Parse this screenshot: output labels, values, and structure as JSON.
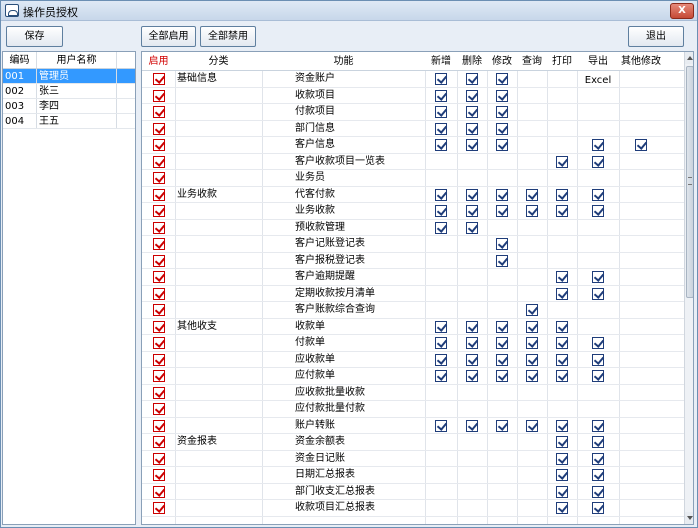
{
  "window": {
    "title": "操作员授权",
    "close_label": "X"
  },
  "toolbar": {
    "save": "保存",
    "enable_all": "全部启用",
    "disable_all": "全部禁用",
    "exit": "退出"
  },
  "users": {
    "headers": [
      "编码",
      "用户名称"
    ],
    "rows": [
      {
        "code": "001",
        "name": "管理员",
        "selected": true
      },
      {
        "code": "002",
        "name": "张三",
        "selected": false
      },
      {
        "code": "003",
        "name": "李四",
        "selected": false
      },
      {
        "code": "004",
        "name": "王五",
        "selected": false
      }
    ]
  },
  "grid": {
    "headers": [
      "启用",
      "分类",
      "功能",
      "新增",
      "删除",
      "修改",
      "查询",
      "打印",
      "导出Excel",
      "其他修改"
    ],
    "rows": [
      {
        "category": "基础信息",
        "func": "资金账户",
        "perms": [
          1,
          1,
          1,
          0,
          0,
          0,
          0
        ]
      },
      {
        "category": "",
        "func": "收款项目",
        "perms": [
          1,
          1,
          1,
          0,
          0,
          0,
          0
        ]
      },
      {
        "category": "",
        "func": "付款项目",
        "perms": [
          1,
          1,
          1,
          0,
          0,
          0,
          0
        ]
      },
      {
        "category": "",
        "func": "部门信息",
        "perms": [
          1,
          1,
          1,
          0,
          0,
          0,
          0
        ]
      },
      {
        "category": "",
        "func": "客户信息",
        "perms": [
          1,
          1,
          1,
          0,
          0,
          1,
          1
        ]
      },
      {
        "category": "",
        "func": "客户收款项目一览表",
        "perms": [
          0,
          0,
          0,
          0,
          1,
          1,
          0
        ]
      },
      {
        "category": "",
        "func": "业务员",
        "perms": [
          0,
          0,
          0,
          0,
          0,
          0,
          0
        ]
      },
      {
        "category": "业务收款",
        "func": "代客付款",
        "perms": [
          1,
          1,
          1,
          1,
          1,
          1,
          0
        ]
      },
      {
        "category": "",
        "func": "业务收款",
        "perms": [
          1,
          1,
          1,
          1,
          1,
          1,
          0
        ]
      },
      {
        "category": "",
        "func": "预收款管理",
        "perms": [
          1,
          1,
          0,
          0,
          0,
          0,
          0
        ]
      },
      {
        "category": "",
        "func": "客户记账登记表",
        "perms": [
          0,
          0,
          1,
          0,
          0,
          0,
          0
        ]
      },
      {
        "category": "",
        "func": "客户报税登记表",
        "perms": [
          0,
          0,
          1,
          0,
          0,
          0,
          0
        ]
      },
      {
        "category": "",
        "func": "客户逾期提醒",
        "perms": [
          0,
          0,
          0,
          0,
          1,
          1,
          0
        ]
      },
      {
        "category": "",
        "func": "定期收款按月清单",
        "perms": [
          0,
          0,
          0,
          0,
          1,
          1,
          0
        ]
      },
      {
        "category": "",
        "func": "客户账款综合查询",
        "perms": [
          0,
          0,
          0,
          1,
          0,
          0,
          0
        ]
      },
      {
        "category": "其他收支",
        "func": "收款单",
        "perms": [
          1,
          1,
          1,
          1,
          1,
          0,
          0
        ]
      },
      {
        "category": "",
        "func": "付款单",
        "perms": [
          1,
          1,
          1,
          1,
          1,
          1,
          0
        ]
      },
      {
        "category": "",
        "func": "应收款单",
        "perms": [
          1,
          1,
          1,
          1,
          1,
          1,
          0
        ]
      },
      {
        "category": "",
        "func": "应付款单",
        "perms": [
          1,
          1,
          1,
          1,
          1,
          1,
          0
        ]
      },
      {
        "category": "",
        "func": "应收款批量收款",
        "perms": [
          0,
          0,
          0,
          0,
          0,
          0,
          0
        ]
      },
      {
        "category": "",
        "func": "应付款批量付款",
        "perms": [
          0,
          0,
          0,
          0,
          0,
          0,
          0
        ]
      },
      {
        "category": "",
        "func": "账户转账",
        "perms": [
          1,
          1,
          1,
          1,
          1,
          1,
          0
        ]
      },
      {
        "category": "资金报表",
        "func": "资金余额表",
        "perms": [
          0,
          0,
          0,
          0,
          1,
          1,
          0
        ]
      },
      {
        "category": "",
        "func": "资金日记账",
        "perms": [
          0,
          0,
          0,
          0,
          1,
          1,
          0
        ]
      },
      {
        "category": "",
        "func": "日期汇总报表",
        "perms": [
          0,
          0,
          0,
          0,
          1,
          1,
          0
        ]
      },
      {
        "category": "",
        "func": "部门收支汇总报表",
        "perms": [
          0,
          0,
          0,
          0,
          1,
          1,
          0
        ]
      },
      {
        "category": "",
        "func": "收款项目汇总报表",
        "perms": [
          0,
          0,
          0,
          0,
          1,
          1,
          0
        ]
      }
    ]
  },
  "colors": {
    "enable_check": "#cc0000",
    "perm_check": "#1f3d7a",
    "selection": "#3399ff"
  }
}
